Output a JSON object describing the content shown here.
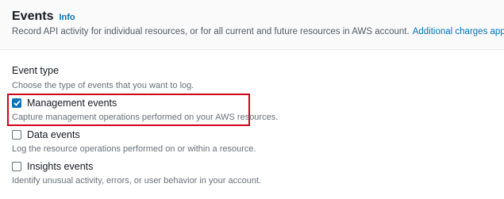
{
  "header": {
    "title": "Events",
    "info_label": "Info",
    "description": "Record API activity for individual resources, or for all current and future resources in AWS account.",
    "charges_link": "Additional charges apply"
  },
  "event_type": {
    "label": "Event type",
    "description": "Choose the type of events that you want to log.",
    "options": [
      {
        "label": "Management events",
        "description": "Capture management operations performed on your AWS resources.",
        "checked": true
      },
      {
        "label": "Data events",
        "description": "Log the resource operations performed on or within a resource.",
        "checked": false
      },
      {
        "label": "Insights events",
        "description": "Identify unusual activity, errors, or user behavior in your account.",
        "checked": false
      }
    ]
  },
  "colors": {
    "accent": "#0073bb",
    "highlight": "#d0021b"
  },
  "icons": {
    "external_link": "external-link-icon",
    "checkmark": "check-icon"
  }
}
